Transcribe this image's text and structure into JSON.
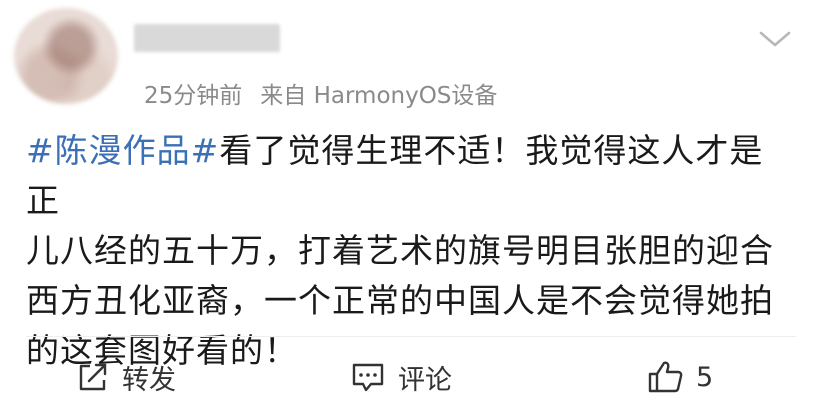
{
  "post": {
    "time": "25分钟前",
    "source": "来自 HarmonyOS设备",
    "content": {
      "topic": "#陈漫作品#",
      "lines": [
        "看了觉得生理不适！我觉得这人才是正",
        "儿八经的五十万，打着艺术的旗号明目张胆的迎合",
        "西方丑化亚裔，一个正常的中国人是不会觉得她拍",
        "的这套图好看的！"
      ]
    },
    "actions": {
      "repost_label": "转发",
      "comment_label": "评论",
      "like_count": "5"
    }
  },
  "colors": {
    "topic_link": "#3b6fb6",
    "meta_text": "#8a8a8a",
    "body_text": "#1a1a1a"
  },
  "icons": [
    "chevron-down-icon",
    "repost-icon",
    "comment-icon",
    "thumbs-up-icon"
  ]
}
